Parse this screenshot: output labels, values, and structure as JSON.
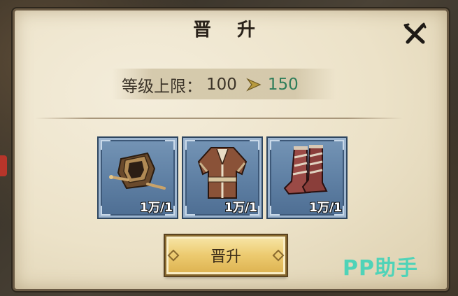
{
  "dialog": {
    "title": "晋 升",
    "level": {
      "label": "等级上限：",
      "current": "100",
      "next": "150"
    },
    "items": [
      {
        "name": "护腕",
        "icon": "bracer-icon",
        "count": "1万/1"
      },
      {
        "name": "衣服",
        "icon": "robe-icon",
        "count": "1万/1"
      },
      {
        "name": "靴子",
        "icon": "boots-icon",
        "count": "1万/1"
      }
    ],
    "button": "晋升"
  },
  "watermark": "PP助手",
  "colors": {
    "next_level": "#2e7d5a",
    "slot_blue": "#5e7fa3",
    "button_gold": "#ecca6f",
    "watermark": "#4fd3b8"
  }
}
